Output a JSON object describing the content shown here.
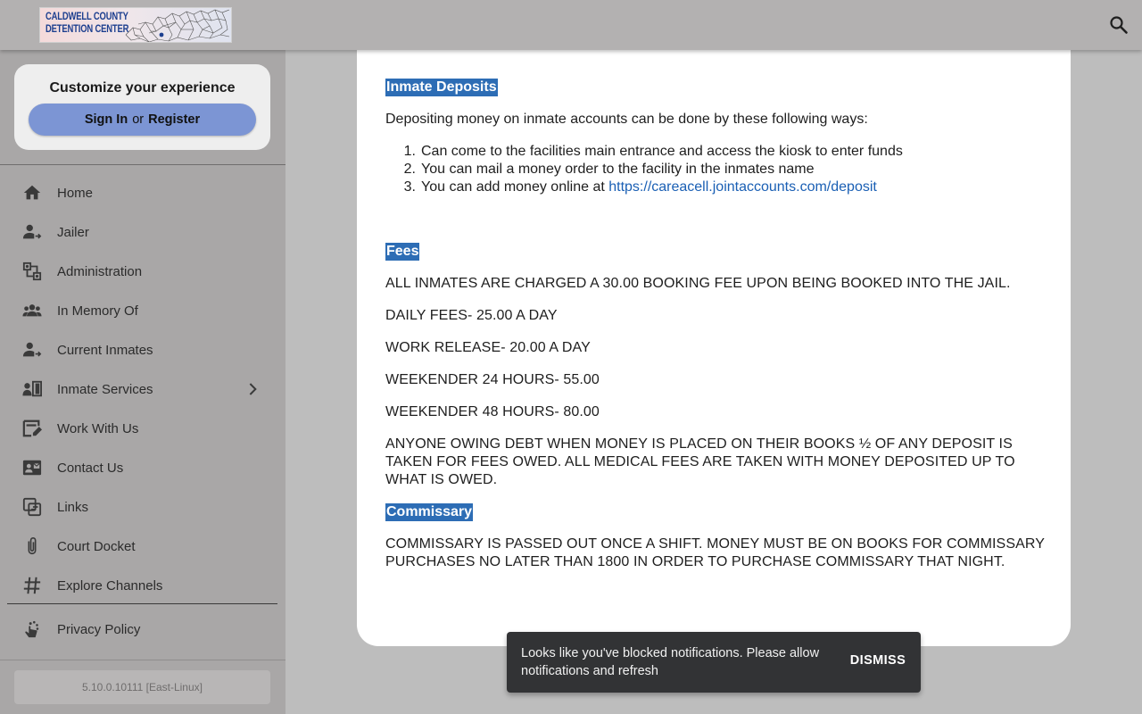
{
  "header": {
    "logo_line1": "CALDWELL COUNTY",
    "logo_line2": "DETENTION CENTER",
    "search_icon": "search-icon"
  },
  "sidebar": {
    "customize_title": "Customize your experience",
    "signin_label": "Sign In",
    "or_label": "or",
    "register_label": "Register",
    "items": [
      {
        "label": "Home",
        "icon": "home-icon"
      },
      {
        "label": "Jailer",
        "icon": "person-arrow-icon"
      },
      {
        "label": "Administration",
        "icon": "account-tree-icon"
      },
      {
        "label": "In Memory Of",
        "icon": "group-icon"
      },
      {
        "label": "Current Inmates",
        "icon": "person-arrow-icon"
      },
      {
        "label": "Inmate Services",
        "icon": "person-panel-icon"
      },
      {
        "label": "Work With Us",
        "icon": "edit-note-icon"
      },
      {
        "label": "Contact Us",
        "icon": "contact-mail-icon"
      },
      {
        "label": "Links",
        "icon": "link-copy-icon"
      },
      {
        "label": "Court Docket",
        "icon": "attachment-icon"
      },
      {
        "label": "Explore Channels",
        "icon": "hashtag-icon"
      }
    ],
    "privacy_label": "Privacy Policy",
    "version": "5.10.0.10111 [East-Linux]"
  },
  "content": {
    "deposits_heading": "Inmate Deposits",
    "deposits_intro": "Depositing money on inmate accounts can be done by these following ways:",
    "deposit_methods": [
      {
        "num": "1.",
        "text": "Can come to the facilities main entrance and access the kiosk to enter funds"
      },
      {
        "num": "2.",
        "text": "You can mail a money order to the facility in the inmates name"
      },
      {
        "num": "3.",
        "text": "You can add money online at ",
        "link": "https://careacell.jointaccounts.com/deposit"
      }
    ],
    "fees_heading": "Fees",
    "booking_fee": "ALL INMATES ARE CHARGED A 30.00 BOOKING FEE UPON BEING BOOKED INTO THE JAIL.",
    "daily_fees": "DAILY FEES- 25.00 A DAY",
    "work_release": "WORK RELEASE- 20.00 A DAY",
    "weekender_24": "WEEKENDER 24 HOURS- 55.00",
    "weekender_48": "WEEKENDER 48 HOURS- 80.00",
    "debt_line1": "ANYONE OWING DEBT WHEN MONEY IS PLACED ON THEIR BOOKS ½ OF ANY DEPOSIT IS",
    "debt_line2": "TAKEN FOR FEES OWED. ALL MEDICAL FEES ARE TAKEN WITH MONEY DEPOSITED UP TO",
    "debt_line3": "WHAT IS OWED.",
    "commissary_heading": "Commissary",
    "commissary_line1": "COMMISSARY IS PASSED OUT ONCE A SHIFT. MONEY MUST BE ON BOOKS FOR COMMISSARY",
    "commissary_line2": "PURCHASES NO LATER THAN 1800 IN ORDER TO PURCHASE COMMISSARY THAT NIGHT."
  },
  "snackbar": {
    "message": "Looks like you've blocked notifications. Please allow notifications and refresh",
    "action": "DISMISS"
  },
  "colors": {
    "topbar": "#b3b1b1",
    "sidebar": "#a9a7a7",
    "page_bg": "#bdbdbd",
    "signin_button": "#7c95d4",
    "heading_highlight": "#2d6db5",
    "link": "#1a5fb4",
    "snackbar": "#323335"
  }
}
